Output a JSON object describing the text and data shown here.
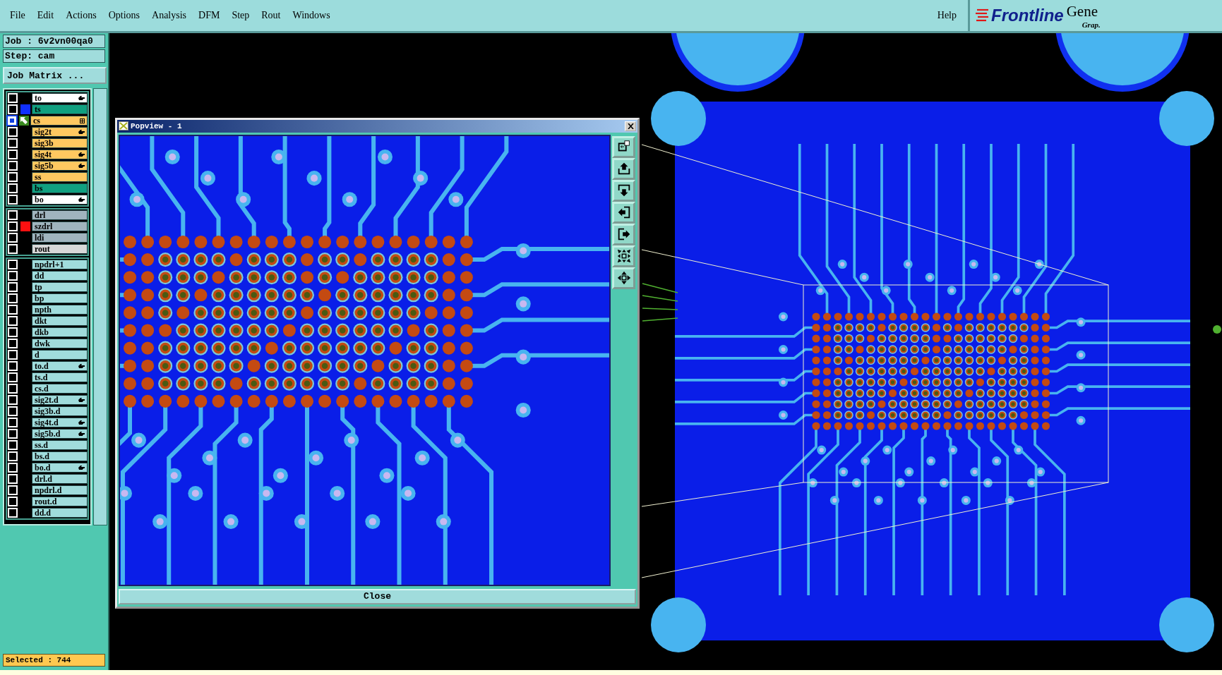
{
  "menu": {
    "items": [
      "File",
      "Edit",
      "Actions",
      "Options",
      "Analysis",
      "DFM",
      "Step",
      "Rout",
      "Windows"
    ],
    "help": "Help"
  },
  "logo": {
    "brand": "Frontline",
    "product": "Gene",
    "subtitle": "Grap."
  },
  "job": {
    "job_label": "Job : 6v2vn00qa0",
    "step_label": "Step: cam",
    "matrix_button": "Job Matrix ..."
  },
  "layer_groups": [
    {
      "layers": [
        {
          "name": "to",
          "color": "#ffffff",
          "hand": true,
          "work_layer": false
        },
        {
          "name": "ts",
          "color": "#10a080",
          "swatch": {
            "color": "#1030ff"
          },
          "hand": false,
          "work_layer": false
        },
        {
          "name": "cs",
          "color": "#ffc860",
          "hand": false,
          "work_layer": true
        },
        {
          "name": "sig2t",
          "color": "#ffc860",
          "hand": true,
          "work_layer": false
        },
        {
          "name": "sig3b",
          "color": "#ffc860",
          "hand": false,
          "work_layer": false
        },
        {
          "name": "sig4t",
          "color": "#ffc860",
          "hand": true,
          "work_layer": false
        },
        {
          "name": "sig5b",
          "color": "#ffc860",
          "hand": true,
          "work_layer": false
        },
        {
          "name": "ss",
          "color": "#ffc860",
          "hand": false,
          "work_layer": false
        },
        {
          "name": "bs",
          "color": "#10a080",
          "hand": false,
          "work_layer": false
        },
        {
          "name": "bo",
          "color": "#ffffff",
          "hand": true,
          "work_layer": false
        }
      ]
    },
    {
      "layers": [
        {
          "name": "drl",
          "color": "#a0b4be",
          "hand": false,
          "work_layer": false
        },
        {
          "name": "szdrl",
          "color": "#a0b4be",
          "swatch": {
            "color": "#ff1010"
          },
          "hand": false,
          "work_layer": false
        },
        {
          "name": "ldi",
          "color": "#a0b4be",
          "hand": false,
          "work_layer": false
        },
        {
          "name": "rout",
          "color": "#d8d8d8",
          "hand": false,
          "work_layer": false
        }
      ]
    },
    {
      "layers": [
        {
          "name": "npdrl+1",
          "color": "#a0dcdc",
          "hand": false,
          "work_layer": false
        },
        {
          "name": "dd",
          "color": "#a0dcdc",
          "hand": false,
          "work_layer": false
        },
        {
          "name": "tp",
          "color": "#a0dcdc",
          "hand": false,
          "work_layer": false
        },
        {
          "name": "bp",
          "color": "#a0dcdc",
          "hand": false,
          "work_layer": false
        },
        {
          "name": "npth",
          "color": "#a0dcdc",
          "hand": false,
          "work_layer": false
        },
        {
          "name": "dkt",
          "color": "#a0dcdc",
          "hand": false,
          "work_layer": false
        },
        {
          "name": "dkb",
          "color": "#a0dcdc",
          "hand": false,
          "work_layer": false
        },
        {
          "name": "dwk",
          "color": "#a0dcdc",
          "hand": false,
          "work_layer": false
        },
        {
          "name": "d",
          "color": "#a0dcdc",
          "hand": false,
          "work_layer": false
        },
        {
          "name": "to.d",
          "color": "#a0dcdc",
          "hand": true,
          "work_layer": false
        },
        {
          "name": "ts.d",
          "color": "#a0dcdc",
          "hand": false,
          "work_layer": false
        },
        {
          "name": "cs.d",
          "color": "#a0dcdc",
          "hand": false,
          "work_layer": false
        },
        {
          "name": "sig2t.d",
          "color": "#a0dcdc",
          "hand": true,
          "work_layer": false
        },
        {
          "name": "sig3b.d",
          "color": "#a0dcdc",
          "hand": false,
          "work_layer": false
        },
        {
          "name": "sig4t.d",
          "color": "#a0dcdc",
          "hand": true,
          "work_layer": false
        },
        {
          "name": "sig5b.d",
          "color": "#a0dcdc",
          "hand": true,
          "work_layer": false
        },
        {
          "name": "ss.d",
          "color": "#a0dcdc",
          "hand": false,
          "work_layer": false
        },
        {
          "name": "bs.d",
          "color": "#a0dcdc",
          "hand": false,
          "work_layer": false
        },
        {
          "name": "bo.d",
          "color": "#a0dcdc",
          "hand": true,
          "work_layer": false
        },
        {
          "name": "drl.d",
          "color": "#a0dcdc",
          "hand": false,
          "work_layer": false
        },
        {
          "name": "npdrl.d",
          "color": "#a0dcdc",
          "hand": false,
          "work_layer": false
        },
        {
          "name": "rout.d",
          "color": "#a0dcdc",
          "hand": false,
          "work_layer": false
        },
        {
          "name": "dd.d",
          "color": "#a0dcdc",
          "hand": false,
          "work_layer": false
        }
      ]
    }
  ],
  "status": {
    "selected": "Selected : 744"
  },
  "popview": {
    "title": "Popview - 1",
    "close_button": "Close",
    "tools": [
      {
        "kind": "window"
      },
      {
        "kind": "up"
      },
      {
        "kind": "down"
      },
      {
        "kind": "left"
      },
      {
        "kind": "right"
      },
      {
        "kind": "fit"
      },
      {
        "kind": "expand"
      }
    ]
  }
}
